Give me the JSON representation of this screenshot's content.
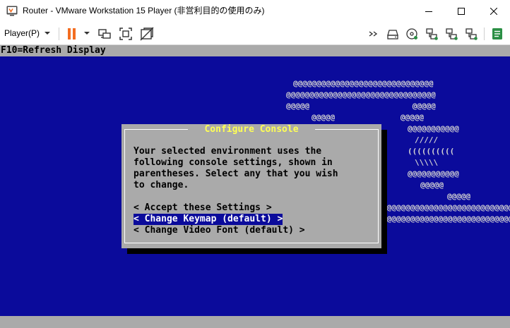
{
  "window": {
    "title": "Router - VMware Workstation 15 Player (非営利目的の使用のみ)",
    "app_icon": "vmware-player-icon",
    "controls": [
      "minimize-icon",
      "maximize-icon",
      "close-icon"
    ]
  },
  "toolbar": {
    "player_menu_label": "Player(P)",
    "left_icons": [
      "pause-icon",
      "dropdown-caret-icon",
      "send-ctrl-alt-del-icon",
      "full-screen-icon",
      "unity-icon"
    ],
    "right_icons": [
      "expand-devices-icon",
      "hard-disk-icon",
      "cd-dvd-icon",
      "network-adapter-icon",
      "network-adapter-2-icon",
      "network-adapter-3-icon",
      "message-log-icon"
    ],
    "accent_color": "#f36d21",
    "log_icon_color": "#2b8f45"
  },
  "console": {
    "background": "#0b0b9b",
    "status_line": "F10=Refresh Display",
    "art_lines": [
      "@@@@@@@@@@@@@@@@@@@@@@@@@@@@@@",
      "@@@@@@@@@@@@@@@@@@@@@@@@@@@@@@@@",
      "@@@@@                      @@@@@",
      "@@@@@              @@@@@",
      "@@@@@@@@@@@",
      "/////",
      "((((((((((",
      "\\\\\\\\\\",
      "@@@@@@@@@@@",
      "@@@@@",
      "@@@@@",
      "@@@@@@@@@@@@@@@@@@@@@@@@@@@@@@@@",
      "@@@@@@@@@@@@@@@@@@@@@@@@@@@@@@@"
    ],
    "dialog": {
      "title": " Configure Console ",
      "body_lines": [
        "Your selected environment uses the",
        "following console settings, shown in",
        "parentheses. Select any that you wish",
        "to change."
      ],
      "options": [
        {
          "label": "< Accept these Settings >",
          "selected": false
        },
        {
          "label": "< Change Keymap (default) >",
          "selected": true
        },
        {
          "label": "< Change Video Font (default) >",
          "selected": false
        }
      ]
    }
  }
}
